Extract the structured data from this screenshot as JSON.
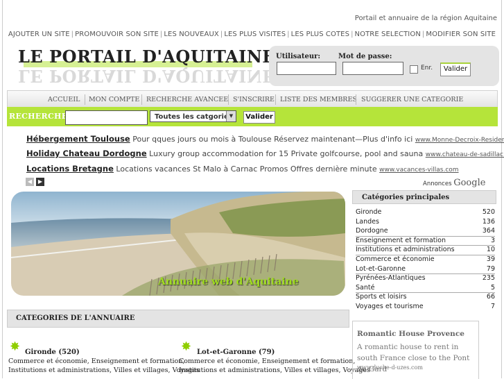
{
  "tagline": "Portail et annuaire de la région Aquitaine",
  "top_nav": [
    "AJOUTER UN SITE",
    "PROMOUVOIR SON SITE",
    "LES NOUVEAUX",
    "LES PLUS VISITES",
    "LES PLUS COTES",
    "NOTRE SELECTION",
    "MODIFIER SON SITE"
  ],
  "logo": "LE PORTAIL D'AQUITAINE",
  "login": {
    "user_label": "Utilisateur:",
    "pass_label": "Mot de passe:",
    "remember_label": "Enr.",
    "submit_label": "Valider"
  },
  "main_nav": [
    "ACCUEIL",
    "MON COMPTE",
    "RECHERCHE AVANCEE",
    "S'INSCRIRE",
    "LISTE DES MEMBRES",
    "SUGGERER UNE CATEGORIE"
  ],
  "search": {
    "label": "RECHERCHE",
    "select_value": "Toutes les catgories",
    "submit_label": "Valider"
  },
  "ads": [
    {
      "title": "Hébergement Toulouse",
      "text": "Pour qques jours ou mois à Toulouse Réservez maintenant—Plus d'info ici",
      "url": "www.Monne-Decroix-Resider"
    },
    {
      "title": "Holiday Chateau Dordogne",
      "text": "Luxury group accommodation for 15 Private golfcourse, pool and sauna",
      "url": "www.chateau-de-sadillac.nl"
    },
    {
      "title": "Locations Bretagne",
      "text": "Locations vacances St Malo à Carnac Promos Offres dernière minute",
      "url": "www.vacances-villas.com"
    }
  ],
  "annonces": {
    "label": "Annonces",
    "brand": "Google"
  },
  "banner_caption": "Annuaire web d'Aquitaine",
  "categories_principales": {
    "title": "Catégories principales",
    "items": [
      {
        "name": "Gironde",
        "count": "520"
      },
      {
        "name": "Landes",
        "count": "136"
      },
      {
        "name": "Dordogne",
        "count": "364"
      },
      {
        "name": "Enseignement et formation",
        "count": "3"
      },
      {
        "name": "Institutions et administrations",
        "count": "10"
      },
      {
        "name": "Commerce et économie",
        "count": "39"
      },
      {
        "name": "Lot-et-Garonne",
        "count": "79"
      },
      {
        "name": "Pyrénées-Atlantiques",
        "count": "235"
      },
      {
        "name": "Santé",
        "count": "5"
      },
      {
        "name": "Sports et loisirs",
        "count": "66"
      },
      {
        "name": "Voyages et tourisme",
        "count": "7"
      }
    ]
  },
  "annuaire": {
    "title": "CATEGORIES DE L'ANNUAIRE",
    "columns": [
      {
        "title": "Gironde (520)",
        "line1": "Commerce et économie, Enseignement et formation,",
        "line2": "Institutions et administrations, Villes et villages, Voyages"
      },
      {
        "title": "Lot-et-Garonne (79)",
        "line1": "Commerce et économie, Enseignement et formation,",
        "line2": "Institutions et administrations, Villes et villages, Voyages"
      }
    ]
  },
  "promo": {
    "title": "Romantic House Provence",
    "text": "A romantic house to rent in south France close to the Pont du Gard",
    "url": "www.duche-d-uzes.com"
  },
  "colors": {
    "accent": "#b5e43a",
    "panel": "#e4e4e4"
  }
}
